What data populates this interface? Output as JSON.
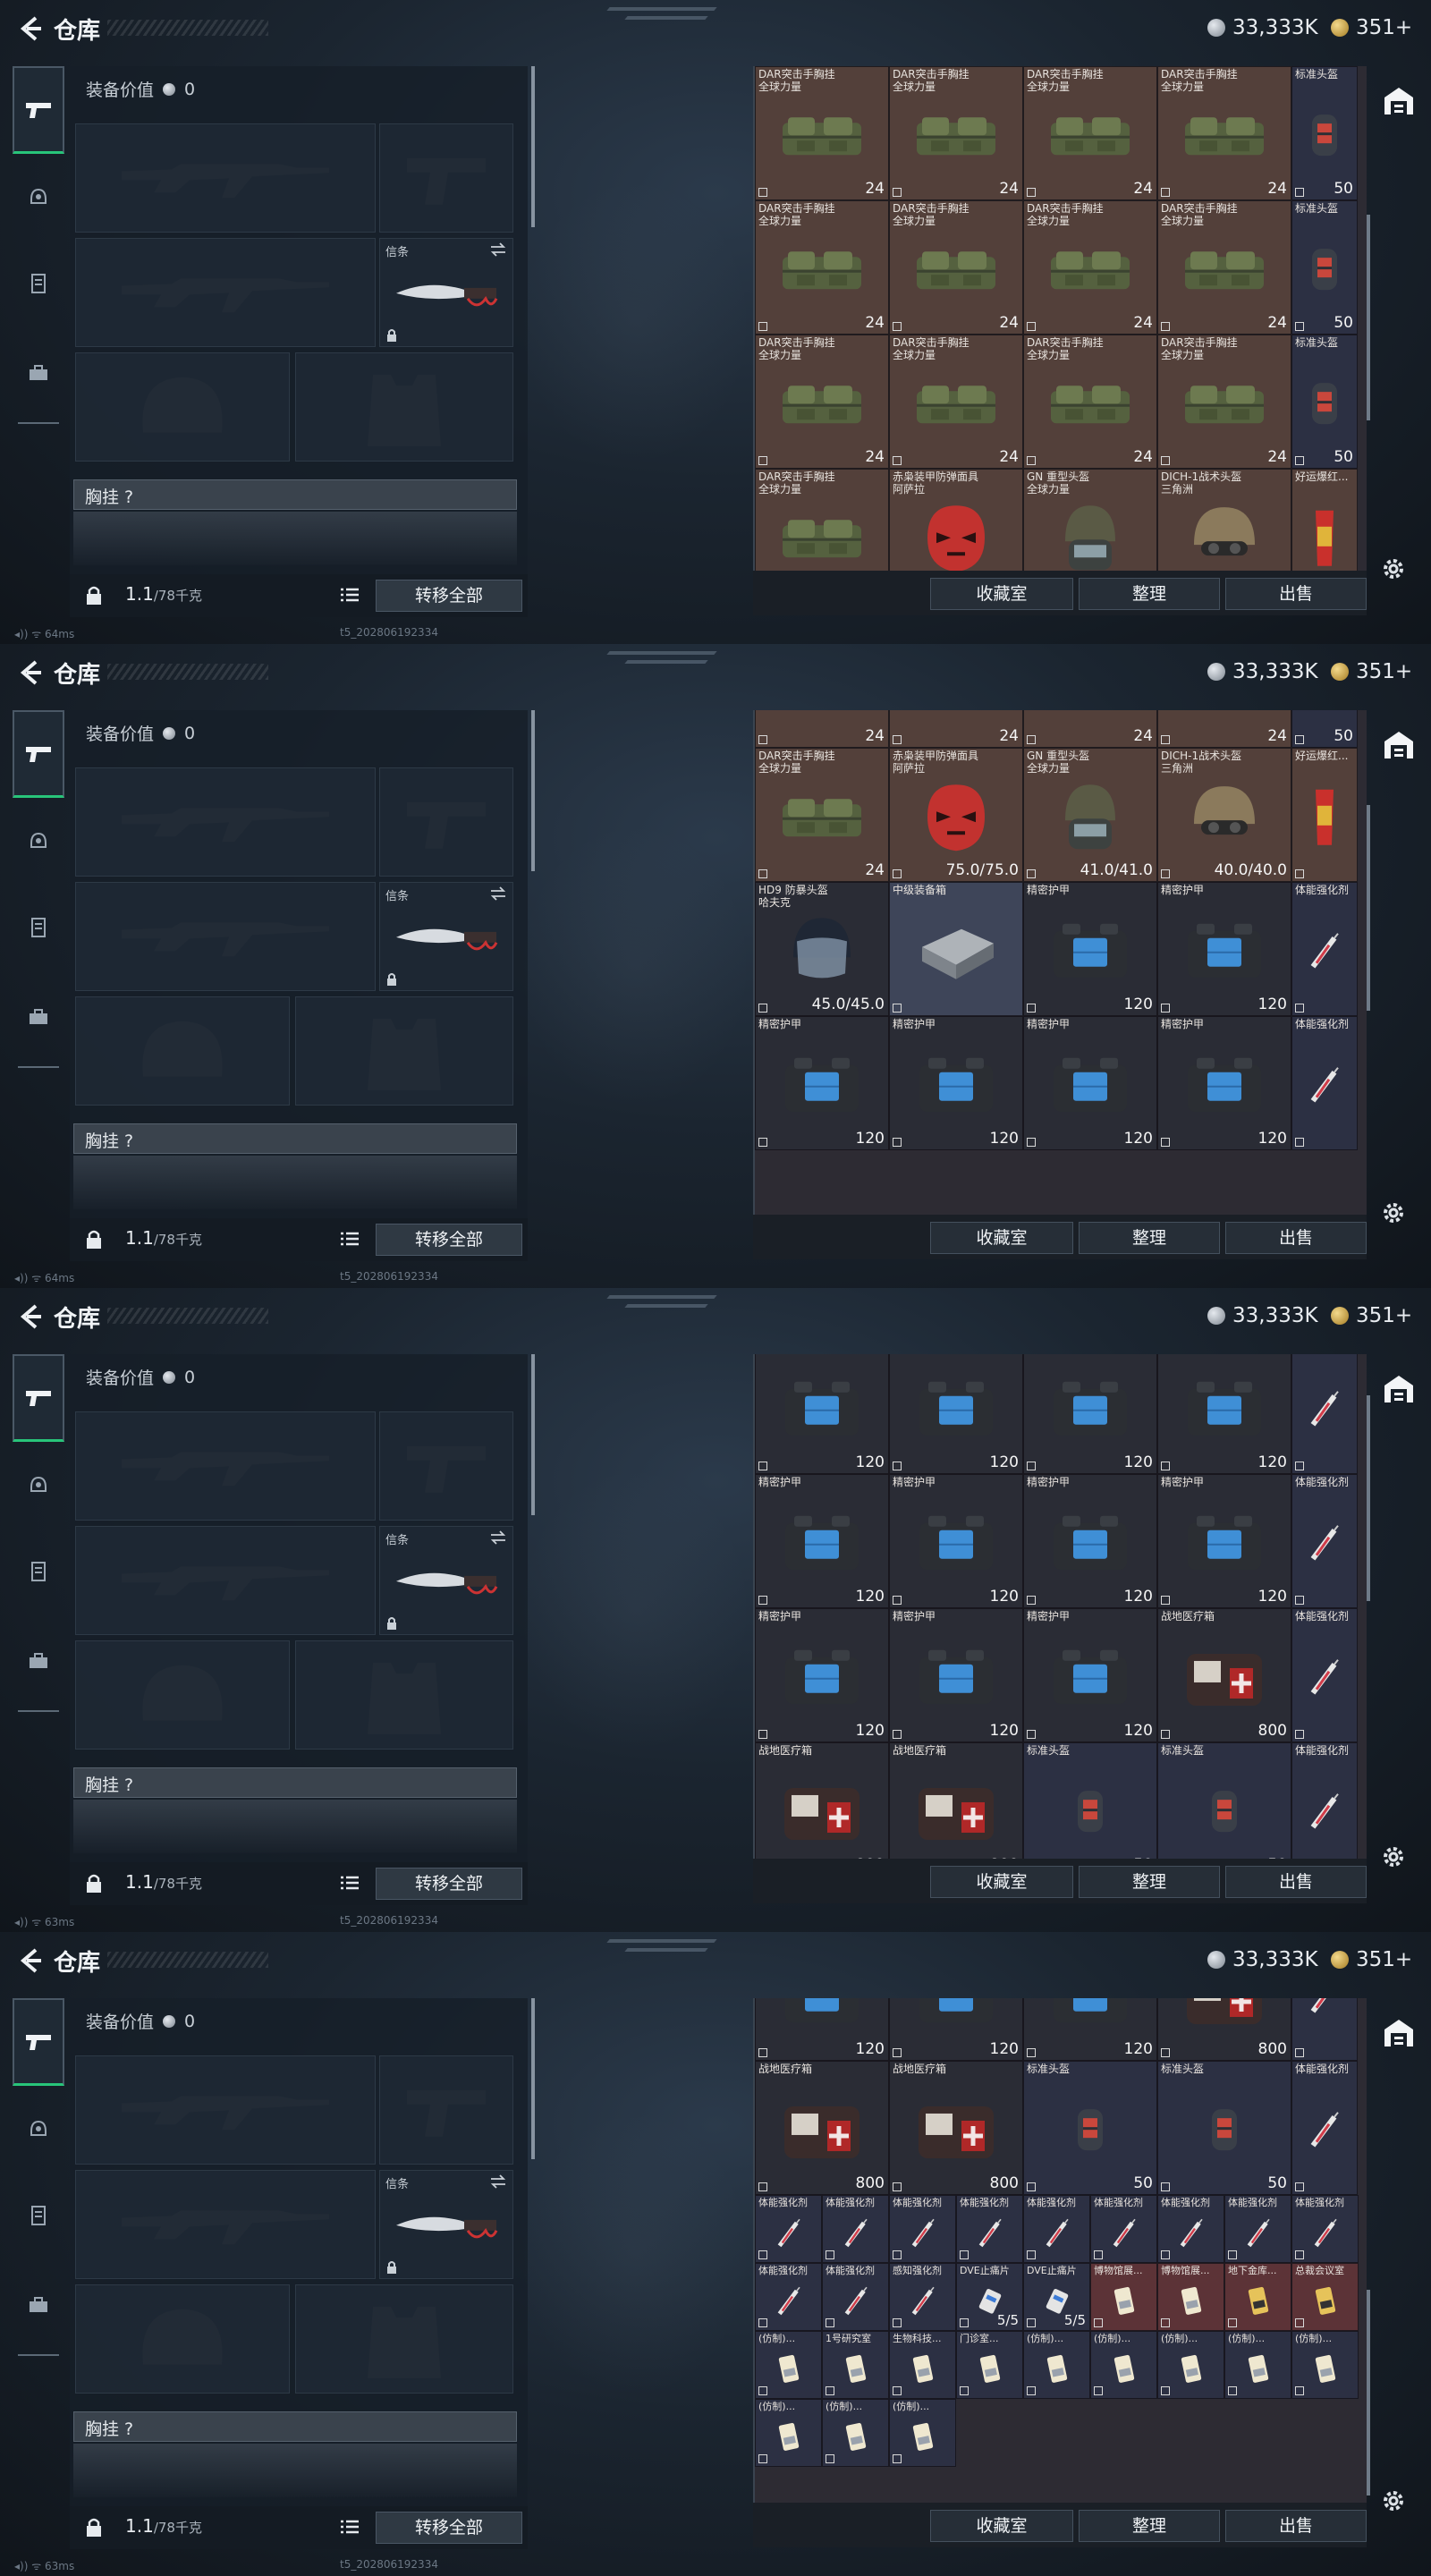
{
  "header": {
    "title": "仓库",
    "silver": "33,333K",
    "gold": "351+"
  },
  "loadout": {
    "value_label": "装备价值",
    "value": "0",
    "secure_slot_label": "信条",
    "chest_rig_label": "胸挂 ?",
    "weight": "1.1",
    "weight_max": "/78千克",
    "transfer_all": "转移全部"
  },
  "inventory_footer": {
    "vault": "收藏室",
    "sort": "整理",
    "sell": "出售"
  },
  "status_lines": [
    {
      "ping": "64ms",
      "build": "t5_202806192334"
    },
    {
      "ping": "64ms",
      "build": "t5_202806192334"
    },
    {
      "ping": "63ms",
      "build": "t5_202806192334"
    },
    {
      "ping": "63ms",
      "build": "t5_202806192334"
    }
  ],
  "items": {
    "dar": {
      "name": "DAR突击手胸挂\n全球力量",
      "value": "24",
      "color": "brown",
      "art": "bag"
    },
    "dar_cut": {
      "name": "",
      "value": "24",
      "color": "brown",
      "art": "bag"
    },
    "helmet_std": {
      "name": "标准头盔",
      "value": "50",
      "color": "navy",
      "art": "helmet-std"
    },
    "helmet_std_cut": {
      "name": "",
      "value": "50",
      "color": "navy",
      "art": "helmet-std"
    },
    "helmet_red": {
      "name": "赤枭装甲防弹面具\n阿萨拉",
      "value": "75.0/75.0",
      "color": "brown",
      "art": "helmet-red"
    },
    "helmet_gn": {
      "name": "GN 重型头盔\n全球力量",
      "value": "41.0/41.0",
      "color": "brown",
      "art": "helmet-gn"
    },
    "helmet_dich": {
      "name": "DICH-1战术头盔\n三角洲",
      "value": "40.0/40.0",
      "color": "brown",
      "art": "helmet-dich"
    },
    "snack": {
      "name": "好运爆红...",
      "value": "",
      "color": "brown",
      "art": "snack"
    },
    "helmet_hd9": {
      "name": "HD9 防暴头盔\n哈夫克",
      "value": "45.0/45.0",
      "color": "dark",
      "art": "helmet-hd9"
    },
    "med_box": {
      "name": "中级装备箱",
      "value": "",
      "color": "blue",
      "art": "case"
    },
    "armor": {
      "name": "精密护甲",
      "value": "120",
      "color": "dark",
      "art": "armor"
    },
    "armor_cut": {
      "name": "",
      "value": "120",
      "color": "dark",
      "art": "armor"
    },
    "stim": {
      "name": "体能强化剂",
      "value": "",
      "color": "navy",
      "art": "syringe"
    },
    "medkit": {
      "name": "战地医疗箱",
      "value": "800",
      "color": "dark",
      "art": "medkit"
    },
    "medkit_cut": {
      "name": "",
      "value": "800",
      "color": "dark",
      "art": "medkit"
    },
    "perc": {
      "name": "感知强化剂",
      "value": "",
      "color": "navy",
      "art": "syringe"
    },
    "dve": {
      "name": "DVE止痛片",
      "value": "5/5",
      "color": "navy",
      "art": "pills"
    },
    "museum1": {
      "name": "博物馆展...",
      "value": "",
      "color": "red",
      "art": "card"
    },
    "museum2": {
      "name": "博物馆展...",
      "value": "",
      "color": "red",
      "art": "card"
    },
    "underground": {
      "name": "地下金库...",
      "value": "",
      "color": "red",
      "art": "card-gold"
    },
    "rescue": {
      "name": "总裁会议室",
      "value": "",
      "color": "red",
      "art": "card-gold"
    },
    "fake": {
      "name": "(仿制)...",
      "value": "",
      "color": "navy",
      "art": "card"
    },
    "lab1": {
      "name": "1号研究室",
      "value": "",
      "color": "navy",
      "art": "card"
    },
    "bio": {
      "name": "生物科技...",
      "value": "",
      "color": "navy",
      "art": "card"
    },
    "clinic": {
      "name": "门诊室...",
      "value": "",
      "color": "navy",
      "art": "card"
    }
  },
  "panels": [
    {
      "rows": [
        [
          "dar",
          "dar",
          "dar",
          "dar",
          "helmet_std"
        ],
        [
          "dar",
          "dar",
          "dar",
          "dar",
          "helmet_std"
        ],
        [
          "dar",
          "dar",
          "dar",
          "dar",
          "helmet_std"
        ],
        [
          "dar",
          "helmet_red",
          "helmet_gn",
          "helmet_dich",
          "snack"
        ]
      ],
      "offset": 0
    },
    {
      "rows": [
        [
          "dar_cut",
          "dar_cut",
          "dar_cut",
          "dar_cut",
          "helmet_std_cut"
        ],
        [
          "dar",
          "helmet_red",
          "helmet_gn",
          "helmet_dich",
          "snack"
        ],
        [
          "helmet_hd9",
          "med_box",
          "armor",
          "armor",
          "stim"
        ],
        [
          "armor",
          "armor",
          "armor",
          "armor",
          "stim"
        ]
      ],
      "offset": -108
    },
    {
      "rows": [
        [
          "armor",
          "armor",
          "armor",
          "armor",
          "stim"
        ],
        [
          "armor",
          "armor",
          "armor",
          "armor",
          "stim"
        ],
        [
          "armor",
          "armor",
          "armor",
          "medkit",
          "stim"
        ],
        [
          "medkit",
          "medkit",
          "helmet_std",
          "helmet_std",
          "stim"
        ]
      ],
      "offset": -16
    }
  ],
  "panel4": {
    "rows": [
      [
        "armor_cut",
        "armor_cut",
        "armor_cut",
        "medkit_cut",
        "stim"
      ],
      [
        "medkit",
        "medkit",
        "helmet_std",
        "helmet_std",
        "stim"
      ],
      [
        "stim",
        "stim",
        "stim",
        "stim",
        "stim",
        "stim",
        "stim",
        "stim",
        "stim"
      ],
      [
        "stim",
        "stim",
        "perc",
        "dve",
        "dve",
        "museum1",
        "museum2",
        "underground",
        "rescue"
      ],
      [
        "fake",
        "lab1",
        "bio",
        "clinic",
        "fake",
        "fake",
        "fake",
        "fake",
        "fake"
      ],
      [
        "fake",
        "fake",
        "fake"
      ]
    ]
  }
}
